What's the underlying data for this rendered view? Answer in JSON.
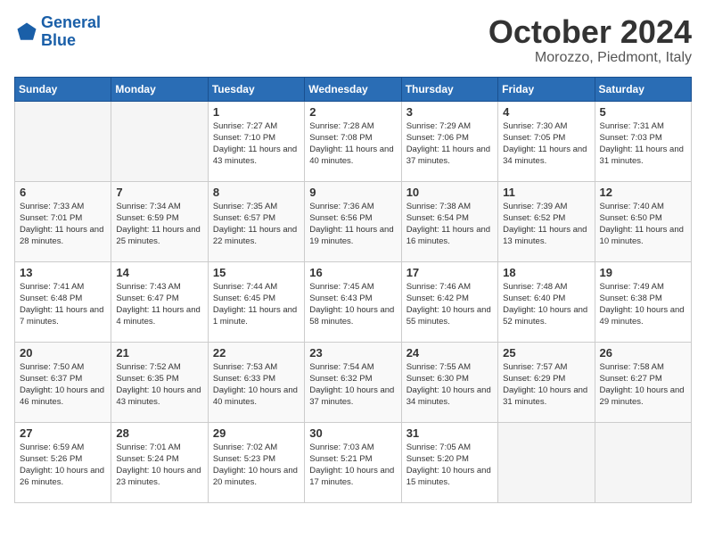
{
  "header": {
    "logo_line1": "General",
    "logo_line2": "Blue",
    "month_title": "October 2024",
    "location": "Morozzo, Piedmont, Italy"
  },
  "days_of_week": [
    "Sunday",
    "Monday",
    "Tuesday",
    "Wednesday",
    "Thursday",
    "Friday",
    "Saturday"
  ],
  "weeks": [
    [
      {
        "num": "",
        "empty": true
      },
      {
        "num": "",
        "empty": true
      },
      {
        "num": "1",
        "sunrise": "Sunrise: 7:27 AM",
        "sunset": "Sunset: 7:10 PM",
        "daylight": "Daylight: 11 hours and 43 minutes."
      },
      {
        "num": "2",
        "sunrise": "Sunrise: 7:28 AM",
        "sunset": "Sunset: 7:08 PM",
        "daylight": "Daylight: 11 hours and 40 minutes."
      },
      {
        "num": "3",
        "sunrise": "Sunrise: 7:29 AM",
        "sunset": "Sunset: 7:06 PM",
        "daylight": "Daylight: 11 hours and 37 minutes."
      },
      {
        "num": "4",
        "sunrise": "Sunrise: 7:30 AM",
        "sunset": "Sunset: 7:05 PM",
        "daylight": "Daylight: 11 hours and 34 minutes."
      },
      {
        "num": "5",
        "sunrise": "Sunrise: 7:31 AM",
        "sunset": "Sunset: 7:03 PM",
        "daylight": "Daylight: 11 hours and 31 minutes."
      }
    ],
    [
      {
        "num": "6",
        "sunrise": "Sunrise: 7:33 AM",
        "sunset": "Sunset: 7:01 PM",
        "daylight": "Daylight: 11 hours and 28 minutes."
      },
      {
        "num": "7",
        "sunrise": "Sunrise: 7:34 AM",
        "sunset": "Sunset: 6:59 PM",
        "daylight": "Daylight: 11 hours and 25 minutes."
      },
      {
        "num": "8",
        "sunrise": "Sunrise: 7:35 AM",
        "sunset": "Sunset: 6:57 PM",
        "daylight": "Daylight: 11 hours and 22 minutes."
      },
      {
        "num": "9",
        "sunrise": "Sunrise: 7:36 AM",
        "sunset": "Sunset: 6:56 PM",
        "daylight": "Daylight: 11 hours and 19 minutes."
      },
      {
        "num": "10",
        "sunrise": "Sunrise: 7:38 AM",
        "sunset": "Sunset: 6:54 PM",
        "daylight": "Daylight: 11 hours and 16 minutes."
      },
      {
        "num": "11",
        "sunrise": "Sunrise: 7:39 AM",
        "sunset": "Sunset: 6:52 PM",
        "daylight": "Daylight: 11 hours and 13 minutes."
      },
      {
        "num": "12",
        "sunrise": "Sunrise: 7:40 AM",
        "sunset": "Sunset: 6:50 PM",
        "daylight": "Daylight: 11 hours and 10 minutes."
      }
    ],
    [
      {
        "num": "13",
        "sunrise": "Sunrise: 7:41 AM",
        "sunset": "Sunset: 6:48 PM",
        "daylight": "Daylight: 11 hours and 7 minutes."
      },
      {
        "num": "14",
        "sunrise": "Sunrise: 7:43 AM",
        "sunset": "Sunset: 6:47 PM",
        "daylight": "Daylight: 11 hours and 4 minutes."
      },
      {
        "num": "15",
        "sunrise": "Sunrise: 7:44 AM",
        "sunset": "Sunset: 6:45 PM",
        "daylight": "Daylight: 11 hours and 1 minute."
      },
      {
        "num": "16",
        "sunrise": "Sunrise: 7:45 AM",
        "sunset": "Sunset: 6:43 PM",
        "daylight": "Daylight: 10 hours and 58 minutes."
      },
      {
        "num": "17",
        "sunrise": "Sunrise: 7:46 AM",
        "sunset": "Sunset: 6:42 PM",
        "daylight": "Daylight: 10 hours and 55 minutes."
      },
      {
        "num": "18",
        "sunrise": "Sunrise: 7:48 AM",
        "sunset": "Sunset: 6:40 PM",
        "daylight": "Daylight: 10 hours and 52 minutes."
      },
      {
        "num": "19",
        "sunrise": "Sunrise: 7:49 AM",
        "sunset": "Sunset: 6:38 PM",
        "daylight": "Daylight: 10 hours and 49 minutes."
      }
    ],
    [
      {
        "num": "20",
        "sunrise": "Sunrise: 7:50 AM",
        "sunset": "Sunset: 6:37 PM",
        "daylight": "Daylight: 10 hours and 46 minutes."
      },
      {
        "num": "21",
        "sunrise": "Sunrise: 7:52 AM",
        "sunset": "Sunset: 6:35 PM",
        "daylight": "Daylight: 10 hours and 43 minutes."
      },
      {
        "num": "22",
        "sunrise": "Sunrise: 7:53 AM",
        "sunset": "Sunset: 6:33 PM",
        "daylight": "Daylight: 10 hours and 40 minutes."
      },
      {
        "num": "23",
        "sunrise": "Sunrise: 7:54 AM",
        "sunset": "Sunset: 6:32 PM",
        "daylight": "Daylight: 10 hours and 37 minutes."
      },
      {
        "num": "24",
        "sunrise": "Sunrise: 7:55 AM",
        "sunset": "Sunset: 6:30 PM",
        "daylight": "Daylight: 10 hours and 34 minutes."
      },
      {
        "num": "25",
        "sunrise": "Sunrise: 7:57 AM",
        "sunset": "Sunset: 6:29 PM",
        "daylight": "Daylight: 10 hours and 31 minutes."
      },
      {
        "num": "26",
        "sunrise": "Sunrise: 7:58 AM",
        "sunset": "Sunset: 6:27 PM",
        "daylight": "Daylight: 10 hours and 29 minutes."
      }
    ],
    [
      {
        "num": "27",
        "sunrise": "Sunrise: 6:59 AM",
        "sunset": "Sunset: 5:26 PM",
        "daylight": "Daylight: 10 hours and 26 minutes."
      },
      {
        "num": "28",
        "sunrise": "Sunrise: 7:01 AM",
        "sunset": "Sunset: 5:24 PM",
        "daylight": "Daylight: 10 hours and 23 minutes."
      },
      {
        "num": "29",
        "sunrise": "Sunrise: 7:02 AM",
        "sunset": "Sunset: 5:23 PM",
        "daylight": "Daylight: 10 hours and 20 minutes."
      },
      {
        "num": "30",
        "sunrise": "Sunrise: 7:03 AM",
        "sunset": "Sunset: 5:21 PM",
        "daylight": "Daylight: 10 hours and 17 minutes."
      },
      {
        "num": "31",
        "sunrise": "Sunrise: 7:05 AM",
        "sunset": "Sunset: 5:20 PM",
        "daylight": "Daylight: 10 hours and 15 minutes."
      },
      {
        "num": "",
        "empty": true
      },
      {
        "num": "",
        "empty": true
      }
    ]
  ]
}
